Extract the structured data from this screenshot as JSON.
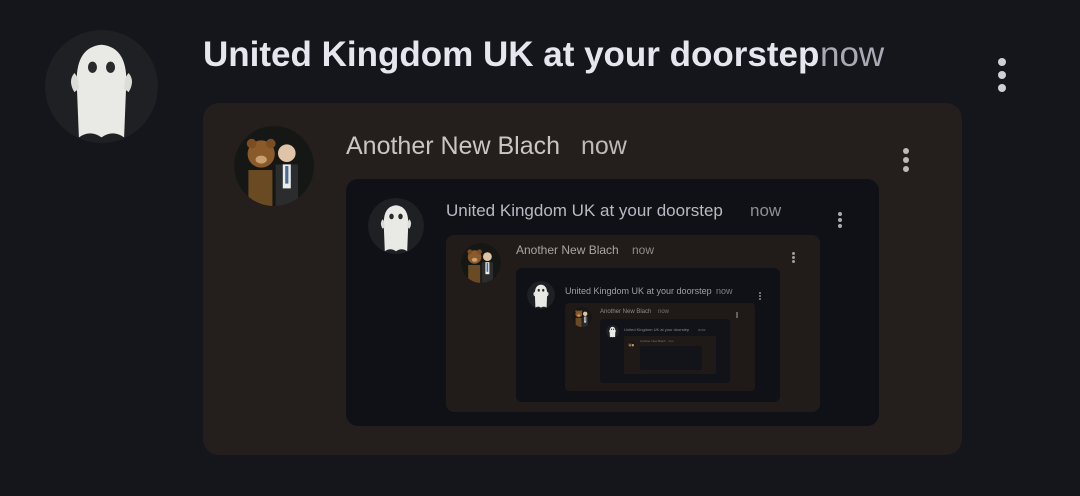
{
  "post": {
    "author": "United Kingdom UK at your doorstep",
    "time": "now",
    "avatar_icon": "ghost-avatar-icon",
    "menu_icon": "more-vertical-icon"
  },
  "quote1": {
    "author": "Another New Blach",
    "time": "now"
  },
  "quote2": {
    "author": "United Kingdom UK at your doorstep",
    "time": "now"
  },
  "quote3": {
    "author": "Another New Blach",
    "time": "now"
  },
  "quote4": {
    "author": "United Kingdom UK at your doorstep",
    "time": "now"
  },
  "quote5": {
    "author": "Another New Blach",
    "time": "now"
  },
  "quote6": {
    "author": "United Kingdom UK at your doorstep",
    "time": "now"
  },
  "quote7": {
    "author": "Another New Blach",
    "time": "now"
  },
  "colors": {
    "background": "#15161b",
    "quote_card_brown": "#241e1c",
    "quote_card_dark": "#101116"
  }
}
